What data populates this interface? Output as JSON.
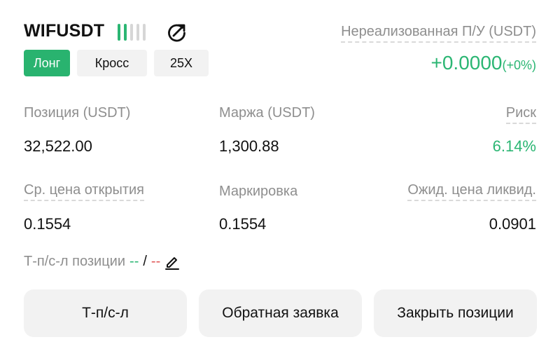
{
  "header": {
    "symbol": "WIFUSDT",
    "side": "Лонг",
    "margin_mode": "Кросс",
    "leverage": "25X",
    "signal_strength_bars": 2,
    "signal_bars_total": 5,
    "share_icon": "share-rotate-icon",
    "colors": {
      "accent_green": "#2bb673",
      "pill_green": "#29b36f"
    }
  },
  "pnl": {
    "label": "Нереализованная П/У (USDT)",
    "value": "+0.0000",
    "percent": "(+0%)"
  },
  "stats": {
    "position_label": "Позиция (USDT)",
    "position_value": "32,522.00",
    "margin_label": "Маржа (USDT)",
    "margin_value": "1,300.88",
    "risk_label": "Риск",
    "risk_value": "6.14%",
    "entry_label": "Ср. цена открытия",
    "entry_value": "0.1554",
    "mark_label": "Маркировка",
    "mark_value": "0.1554",
    "liq_label": "Ожид. цена ликвид.",
    "liq_value": "0.0901"
  },
  "tpsl": {
    "label": "Т-п/с-л позиции",
    "tp": "--",
    "separator": "/",
    "sl": "--",
    "edit_icon": "pencil-icon"
  },
  "buttons": {
    "tpsl": "Т-п/с-л",
    "reverse": "Обратная заявка",
    "close": "Закрыть позиции"
  }
}
